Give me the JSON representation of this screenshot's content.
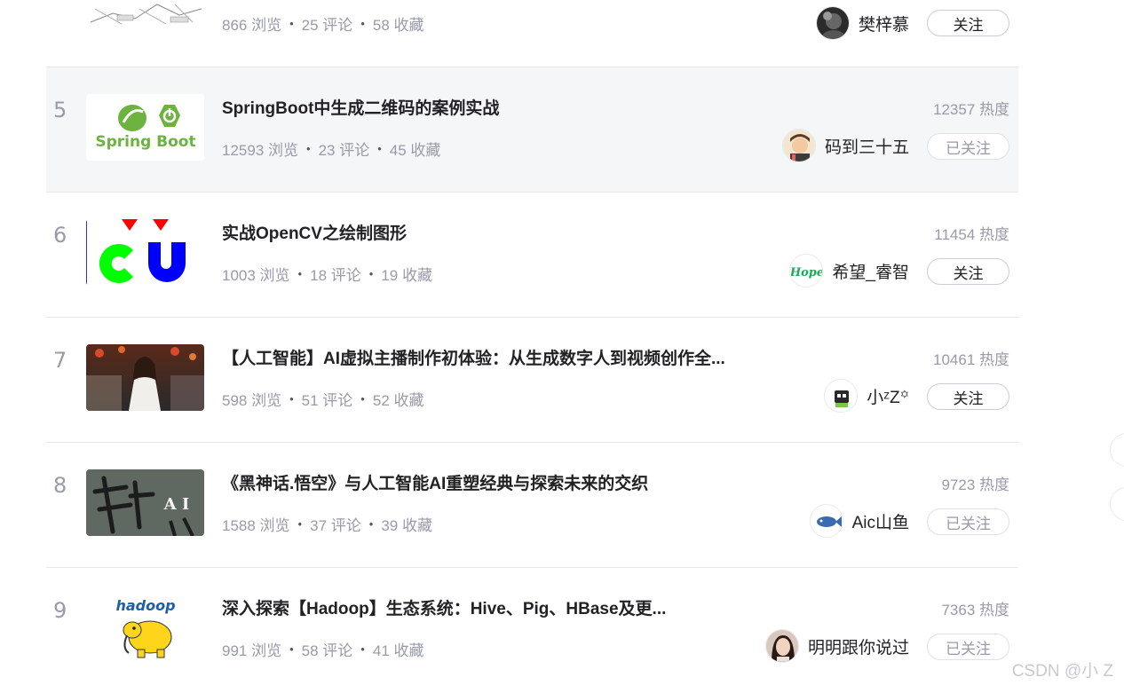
{
  "items": [
    {
      "stats": {
        "views": "866 浏览",
        "comments": "25 评论",
        "favorites": "58 收藏"
      },
      "author": "樊梓慕",
      "follow": "关注",
      "followed": false
    },
    {
      "rank": "5",
      "title": "SpringBoot中生成二维码的案例实战",
      "stats": {
        "views": "12593 浏览",
        "comments": "23 评论",
        "favorites": "45 收藏"
      },
      "heat": "12357 热度",
      "author": "码到三十五",
      "follow": "已关注",
      "followed": true,
      "thumb_text": "Spring Boot"
    },
    {
      "rank": "6",
      "title": "实战OpenCV之绘制图形",
      "stats": {
        "views": "1003 浏览",
        "comments": "18 评论",
        "favorites": "19 收藏"
      },
      "heat": "11454 热度",
      "author": "希望_睿智",
      "follow": "关注",
      "followed": false,
      "avatar_text": "Hope"
    },
    {
      "rank": "7",
      "title": "【人工智能】AI虚拟主播制作初体验：从生成数字人到视频创作全...",
      "stats": {
        "views": "598 浏览",
        "comments": "51 评论",
        "favorites": "52 收藏"
      },
      "heat": "10461 热度",
      "author": "小ᶻZ꙳",
      "follow": "关注",
      "followed": false
    },
    {
      "rank": "8",
      "title": "《黑神话.悟空》与人工智能AI重塑经典与探索未来的交织",
      "stats": {
        "views": "1588 浏览",
        "comments": "37 评论",
        "favorites": "39 收藏"
      },
      "heat": "9723 热度",
      "author": "Aic山鱼",
      "follow": "已关注",
      "followed": true,
      "thumb_text": "A I"
    },
    {
      "rank": "9",
      "title": "深入探索【Hadoop】生态系统：Hive、Pig、HBase及更...",
      "stats": {
        "views": "991 浏览",
        "comments": "58 评论",
        "favorites": "41 收藏"
      },
      "heat": "7363 热度",
      "author": "明明跟你说过",
      "follow": "已关注",
      "followed": true,
      "thumb_text": "hadoop"
    }
  ],
  "watermark": "CSDN @小 Z",
  "colors": {
    "heading": "#222226",
    "muted": "#999aaa",
    "hover_bg": "#f5f6f7",
    "divider": "#e8e8ed"
  }
}
